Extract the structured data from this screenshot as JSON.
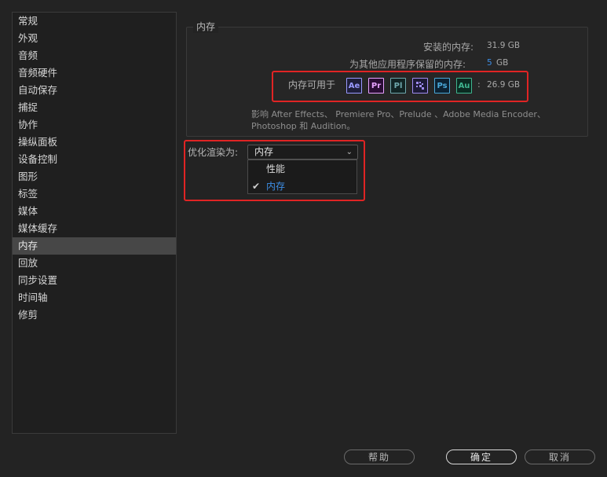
{
  "sidebar": {
    "items": [
      {
        "label": "常规"
      },
      {
        "label": "外观"
      },
      {
        "label": "音频"
      },
      {
        "label": "音频硬件"
      },
      {
        "label": "自动保存"
      },
      {
        "label": "捕捉"
      },
      {
        "label": "协作"
      },
      {
        "label": "操纵面板"
      },
      {
        "label": "设备控制"
      },
      {
        "label": "图形"
      },
      {
        "label": "标签"
      },
      {
        "label": "媒体"
      },
      {
        "label": "媒体缓存"
      },
      {
        "label": "内存"
      },
      {
        "label": "回放"
      },
      {
        "label": "同步设置"
      },
      {
        "label": "时间轴"
      },
      {
        "label": "修剪"
      }
    ],
    "active_index": 13
  },
  "memory": {
    "group_title": "内存",
    "installed_label": "安装的内存:",
    "installed_value": "31.9 GB",
    "reserved_label": "为其他应用程序保留的内存:",
    "reserved_value": "5",
    "reserved_unit": "GB",
    "available_label": "内存可用于",
    "available_colon": ":",
    "available_value": "26.9 GB",
    "apps": [
      {
        "abbr": "Ae",
        "color": "#9999ff",
        "bg": "#1e1e3a",
        "name": "ae-badge-icon"
      },
      {
        "abbr": "Pr",
        "color": "#e8a3ff",
        "bg": "#2b0d35",
        "name": "pr-badge-icon"
      },
      {
        "abbr": "Pl",
        "color": "#6fa8ad",
        "bg": "#112424",
        "name": "pl-badge-icon"
      },
      {
        "abbr": "",
        "color": "#9f8cf0",
        "bg": "#1d1a36",
        "name": "media-encoder-badge-icon"
      },
      {
        "abbr": "Ps",
        "color": "#4aa8d8",
        "bg": "#0c2233",
        "name": "ps-badge-icon"
      },
      {
        "abbr": "Au",
        "color": "#3fb58f",
        "bg": "#0b2a21",
        "name": "au-badge-icon"
      }
    ],
    "affects_text": "影响 After Effects、 Premiere Pro、Prelude 、Adobe Media Encoder、Photoshop 和 Audition。"
  },
  "optimize": {
    "label": "优化渲染为:",
    "selected": "内存",
    "chevron": "⌄",
    "options": [
      {
        "label": "性能",
        "checked": false
      },
      {
        "label": "内存",
        "checked": true
      }
    ],
    "check_glyph": "✔"
  },
  "buttons": {
    "help": "帮助",
    "ok": "确定",
    "cancel": "取消"
  },
  "colors": {
    "highlight_border": "#e02424",
    "accent_blue": "#3d8ee6",
    "active_sidebar": "#474747"
  }
}
